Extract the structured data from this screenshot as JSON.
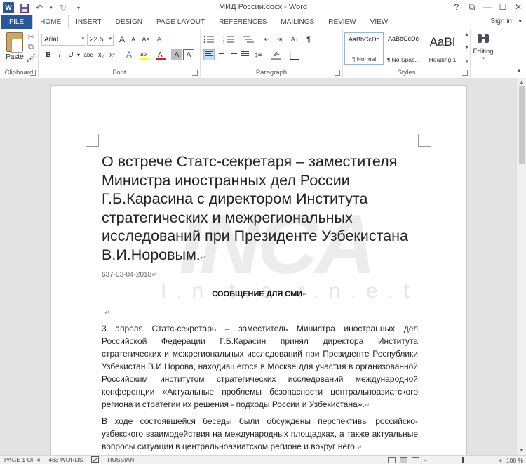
{
  "window": {
    "title": "МИД России.docx - Word",
    "help": "?",
    "restore": "⧉",
    "minimize": "—",
    "maximize": "☐",
    "close": "✕"
  },
  "tabs": [
    "FILE",
    "HOME",
    "INSERT",
    "DESIGN",
    "PAGE LAYOUT",
    "REFERENCES",
    "MAILINGS",
    "REVIEW",
    "VIEW"
  ],
  "account": {
    "signin": "Sign in"
  },
  "ribbon": {
    "clipboard": {
      "paste": "Paste",
      "label": "Clipboard"
    },
    "font": {
      "name": "Arial",
      "size": "22.5",
      "label": "Font",
      "bold": "B",
      "italic": "I",
      "underline": "U",
      "strike": "abc",
      "sub": "x₂",
      "sup": "x²",
      "clear": "A",
      "grow": "A",
      "shrink": "A",
      "case": "Aa"
    },
    "paragraph": {
      "label": "Paragraph"
    },
    "styles": {
      "label": "Styles",
      "items": [
        {
          "preview": "AaBbCcDc",
          "name": "¶ Normal"
        },
        {
          "preview": "AaBbCcDc",
          "name": "¶ No Spac..."
        },
        {
          "preview": "AaBI",
          "name": "Heading 1"
        }
      ]
    },
    "editing": {
      "label": "Editing"
    }
  },
  "document": {
    "heading": "О встрече Статс-секретаря – заместителя Министра иностранных дел России Г.Б.Карасина с директором Института стратегических и межрегиональных исследований при Президенте Узбекистана В.И.Норовым.",
    "meta": "637-03-04-2018",
    "release": "СООБЩЕНИЕ ДЛЯ СМИ",
    "watermark": "INCA",
    "watermark_sub": "I.n.t.e.r.n.e.t",
    "pilcrow": "↵",
    "paragraphs": [
      "3 апреля Статс-секретарь – заместитель Министра иностранных дел Российской Федерации Г.Б.Карасин принял директора Института стратегических и межрегиональных исследований при Президенте Республики Узбекистан В.И.Норова, находившегося в Москве для участия в организованной Российским институтом стратегических исследований международной конференции «Актуальные проблемы безопасности центральноазиатского региона и стратегии их решения - подходы России и Узбекистана».",
      "В ходе состоявшейся беседы были обсуждены перспективы российско-узбекского взаимодействия на международных площадках, а также актуальные вопросы ситуации в центральноазиатском регионе и вокруг него."
    ]
  },
  "status": {
    "page": "PAGE 1 OF 4",
    "words": "463 WORDS",
    "language": "RUSSIAN",
    "zoom_out": "−",
    "zoom_in": "+",
    "zoom": "100 %"
  }
}
